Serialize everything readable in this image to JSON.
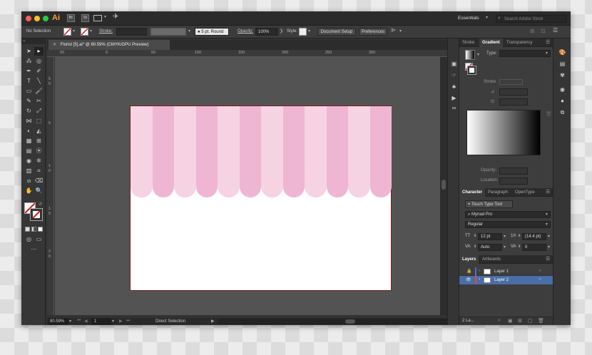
{
  "app": {
    "logo": "Ai",
    "br": "Br",
    "st": "St",
    "workspace": "Essentials",
    "search_placeholder": "Search Adobe Stock"
  },
  "control_bar": {
    "selection": "No Selection",
    "stroke_label": "Stroke:",
    "brush": "5 pt. Round",
    "opacity_label": "Opacity:",
    "opacity_value": "100%",
    "style_label": "Style:",
    "doc_setup": "Document Setup",
    "preferences": "Preferences"
  },
  "document": {
    "tab_title": "Florist [5].ai* @ 80.59% (CMYK/GPU Preview)",
    "ruler_marks": [
      "50",
      "0",
      "50",
      "100",
      "150",
      "200",
      "250",
      "300"
    ],
    "vruler_marks": [
      "5",
      "0",
      "5",
      "1",
      "0",
      "1",
      "5",
      "2",
      "0"
    ],
    "stripe_colors": [
      "#f5d3e3",
      "#eeb6d3"
    ]
  },
  "status": {
    "zoom": "80.59%",
    "artboard_num": "1",
    "tool": "Direct Selection"
  },
  "panels": {
    "gradient": {
      "tabs": [
        "Stroke",
        "Gradient",
        "Transparency"
      ],
      "type_label": "Type:",
      "stroke_label": "Stroke",
      "opacity_label": "Opacity:",
      "location_label": "Location:"
    },
    "character": {
      "tabs": [
        "Character",
        "Paragraph",
        "OpenType"
      ],
      "touch_tool": "Touch Type Tool",
      "font_family": "Myriad Pro",
      "font_style": "Regular",
      "size": "12 pt",
      "leading": "(14.4 pt)",
      "tracking": "Auto",
      "kerning": "0"
    },
    "layers": {
      "tabs": [
        "Layers",
        "Artboards"
      ],
      "items": [
        {
          "name": "Layer 1",
          "color": "#4f6bd8"
        },
        {
          "name": "Layer 2",
          "color": "#d84b4b"
        }
      ],
      "count": "2 La..."
    }
  },
  "colors": {
    "accent_select": "#4a6ea6",
    "artboard_border": "#7a1d1d"
  }
}
